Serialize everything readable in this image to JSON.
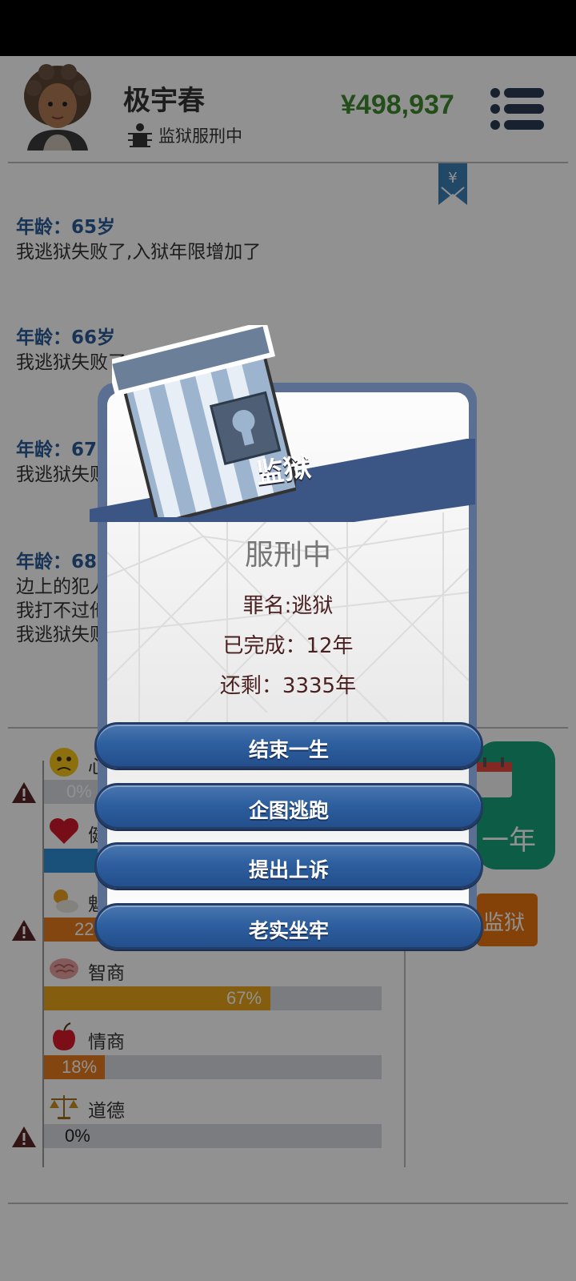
{
  "header": {
    "name": "极宇春",
    "status": "监狱服刑中",
    "money": "¥498,937"
  },
  "log": [
    {
      "age": "年龄：65岁",
      "lines": [
        "我逃狱失败了,入狱年限增加了"
      ]
    },
    {
      "age": "年龄：66岁",
      "lines": [
        "我逃狱失败了,入狱年限增加了"
      ]
    },
    {
      "age": "年龄：67岁",
      "lines": [
        "我逃狱失败了,入狱年限增加了"
      ]
    },
    {
      "age": "年龄：68岁",
      "lines": [
        "边上的犯人嚣张得很，天天对我颐指气使，要不要去揍他",
        "我打不过他",
        "我逃狱失败了,入狱年限增加了"
      ]
    }
  ],
  "stats": [
    {
      "label": "心情",
      "pct": "0%",
      "value": 0,
      "color": "#e8a012",
      "warn": true
    },
    {
      "label": "健康",
      "pct": "",
      "value": 0.3,
      "color": "#2f8fd8",
      "warn": false
    },
    {
      "label": "魅力",
      "pct": "22%",
      "value": 0.22,
      "color": "#e87c1e",
      "warn": true
    },
    {
      "label": "智商",
      "pct": "67%",
      "value": 0.67,
      "color": "#eaa41a",
      "warn": false
    },
    {
      "label": "情商",
      "pct": "18%",
      "value": 0.18,
      "color": "#e87c1e",
      "warn": false
    },
    {
      "label": "道德",
      "pct": "0%",
      "value": 0,
      "color": "#e87c1e",
      "warn": true
    }
  ],
  "side": {
    "next_year": "一年",
    "prison": "监狱"
  },
  "modal": {
    "title": "监狱",
    "serving": "服刑中",
    "crime": "罪名:逃狱",
    "done": "已完成：12年",
    "remaining": "还剩：3335年",
    "buttons": [
      "结束一生",
      "企图逃跑",
      "提出上诉",
      "老实坐牢"
    ]
  },
  "colors": {
    "money": "#3f8a2e",
    "age_text": "#2a5c9a",
    "button_blue": "#2e5f9f",
    "next_year_green": "#17a37a",
    "prison_orange": "#e8730f"
  }
}
